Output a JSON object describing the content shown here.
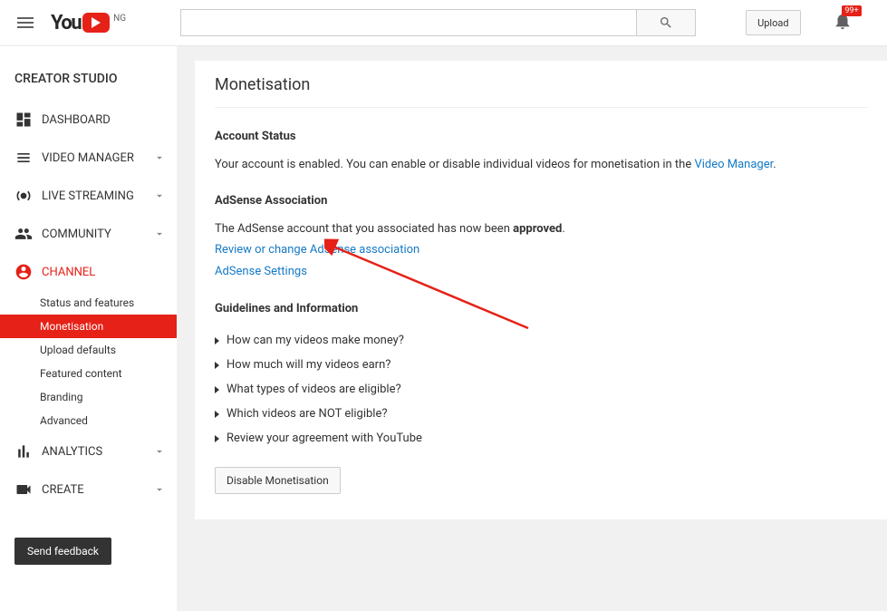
{
  "header": {
    "logo_text": "You",
    "country": "NG",
    "upload_label": "Upload",
    "notification_badge": "99+"
  },
  "sidebar": {
    "title": "CREATOR STUDIO",
    "items": [
      {
        "label": "DASHBOARD"
      },
      {
        "label": "VIDEO MANAGER"
      },
      {
        "label": "LIVE STREAMING"
      },
      {
        "label": "COMMUNITY"
      },
      {
        "label": "CHANNEL"
      },
      {
        "label": "ANALYTICS"
      },
      {
        "label": "CREATE"
      }
    ],
    "channel_sub": [
      {
        "label": "Status and features"
      },
      {
        "label": "Monetisation"
      },
      {
        "label": "Upload defaults"
      },
      {
        "label": "Featured content"
      },
      {
        "label": "Branding"
      },
      {
        "label": "Advanced"
      }
    ],
    "feedback_label": "Send feedback"
  },
  "main": {
    "page_title": "Monetisation",
    "account_status": {
      "heading": "Account Status",
      "text_before": "Your account is enabled. You can enable or disable individual videos for monetisation in the ",
      "link_text": "Video Manager",
      "text_after": "."
    },
    "adsense": {
      "heading": "AdSense Association",
      "text_before": "The AdSense account that you associated has now been ",
      "approved": "approved",
      "text_after": ".",
      "link1": "Review or change AdSense association",
      "link2": "AdSense Settings"
    },
    "guidelines": {
      "heading": "Guidelines and Information",
      "items": [
        "How can my videos make money?",
        "How much will my videos earn?",
        "What types of videos are eligible?",
        "Which videos are NOT eligible?",
        "Review your agreement with YouTube"
      ]
    },
    "disable_label": "Disable Monetisation"
  }
}
